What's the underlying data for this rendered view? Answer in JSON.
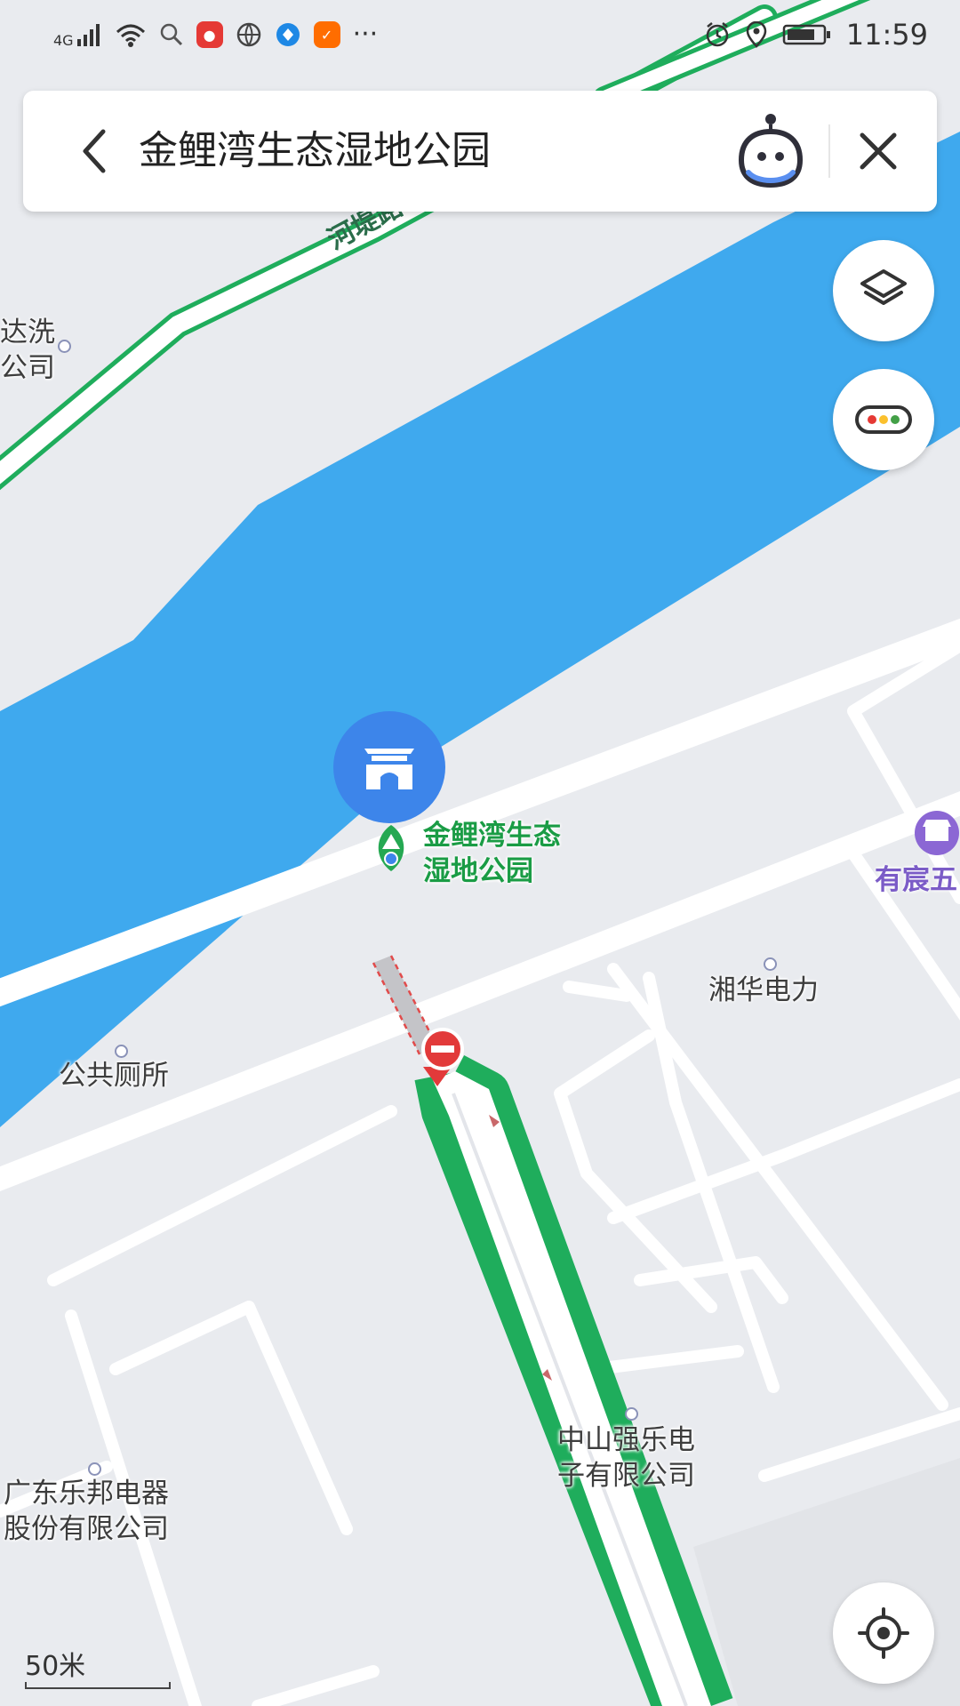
{
  "status_bar": {
    "network": "4G",
    "time": "11:59",
    "more": "···"
  },
  "search": {
    "query": "金鲤湾生态湿地公园"
  },
  "map": {
    "park_name_line1": "金鲤湾生态",
    "park_name_line2": "湿地公园",
    "road_label": "河堤路",
    "pois": {
      "top_left_line1": "达洗",
      "top_left_line2": "公司",
      "toilet": "公共厕所",
      "xianghua": "湘华电力",
      "zhongshan_line1": "中山强乐电",
      "zhongshan_line2": "子有限公司",
      "guangdong_line1": "广东乐邦电器",
      "guangdong_line2": "股份有限公司",
      "shop": "有宸五"
    },
    "scale_label": "50米"
  },
  "colors": {
    "water": "#3fa9ee",
    "land": "#e9ebef",
    "road": "#ffffff",
    "route": "#1fad5c",
    "park_pin": "#3d85ea",
    "park_text": "#1a9c45",
    "shop_text": "#7b5cc7",
    "no_entry": "#e23a3a"
  },
  "icons": {
    "back": "chevron-left-icon",
    "assistant": "assistant-robot-icon",
    "close": "close-icon",
    "layers": "layers-icon",
    "traffic": "traffic-light-icon",
    "locate": "locate-icon",
    "park": "park-gate-icon",
    "shop": "shop-icon",
    "no_entry": "no-entry-icon"
  }
}
